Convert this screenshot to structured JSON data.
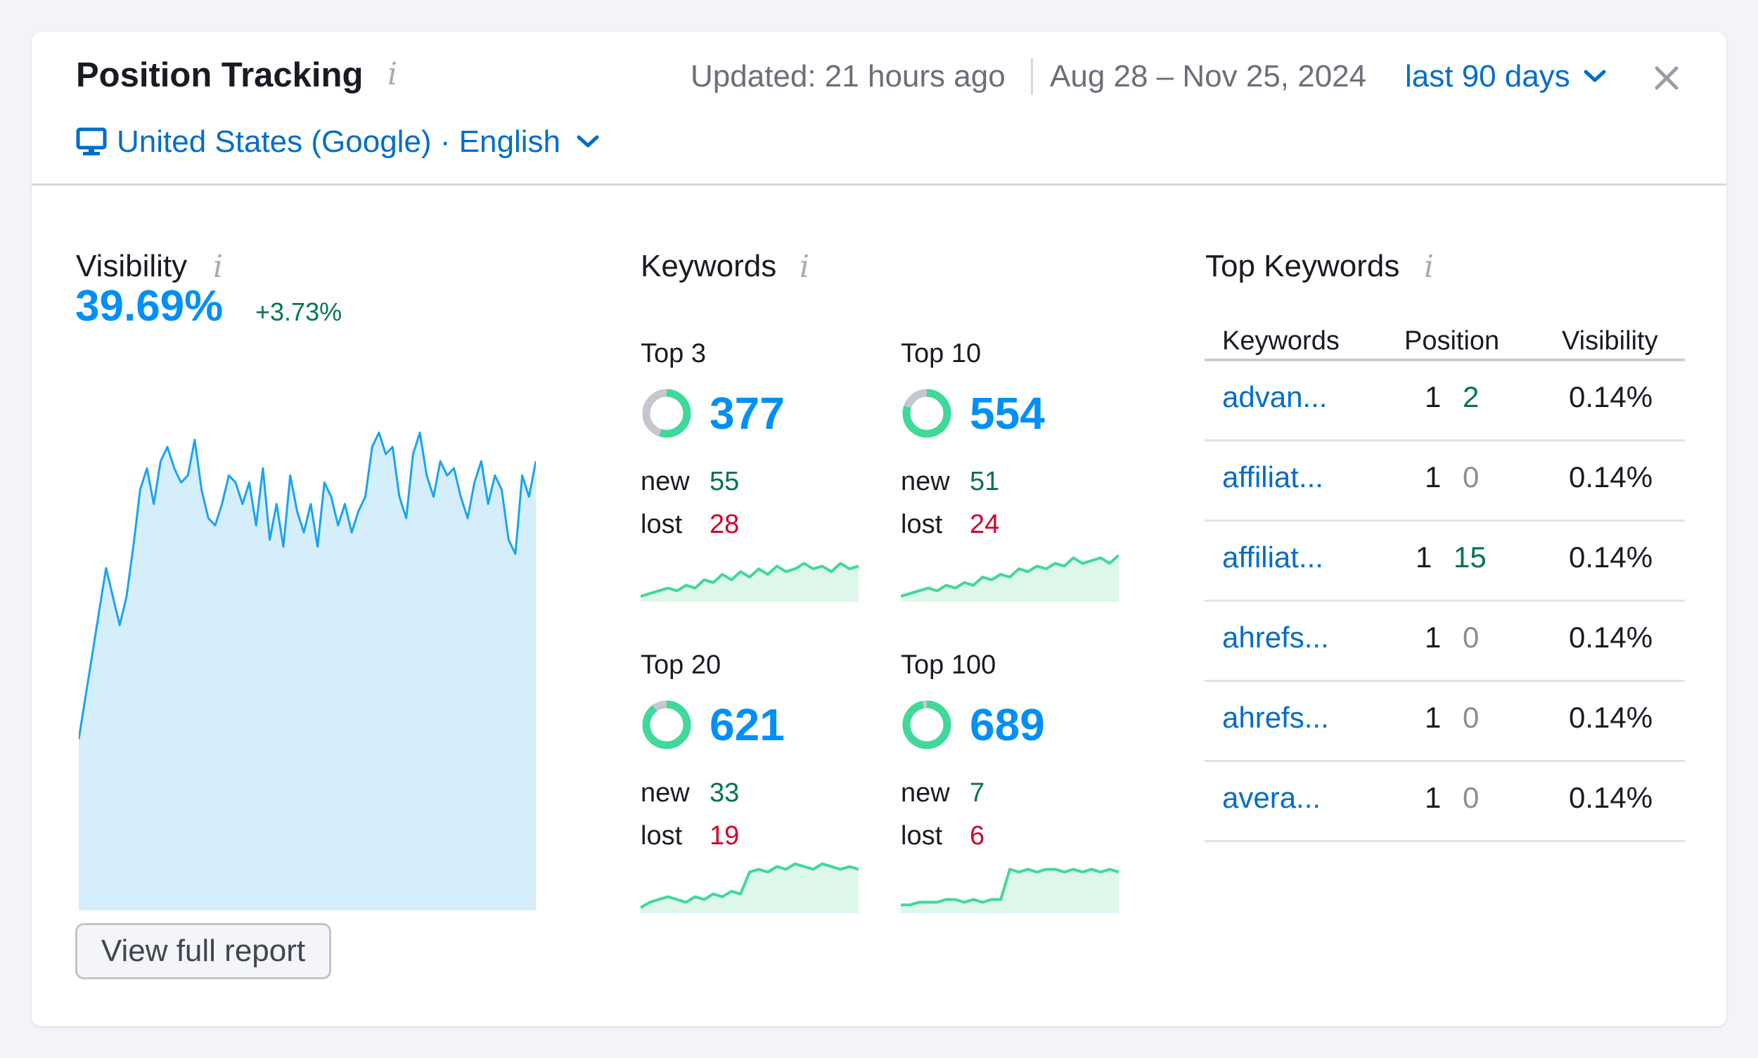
{
  "header": {
    "title": "Position Tracking",
    "info_glyph": "i",
    "updated": "Updated: 21 hours ago",
    "date_range": "Aug 28 – Nov 25, 2024",
    "period": "last 90 days",
    "close_icon": "close-icon",
    "location": "United States (Google) · English",
    "location_icon": "desktop-monitor-icon"
  },
  "visibility": {
    "title": "Visibility",
    "value": "39.69%",
    "delta": "+3.73%",
    "chart_data": {
      "type": "area",
      "values": [
        24,
        30,
        36,
        42,
        48,
        44,
        40,
        44,
        51,
        59,
        62,
        57,
        63,
        65,
        62,
        60,
        61,
        66,
        59,
        55,
        54,
        57,
        61,
        60,
        57,
        60,
        54,
        62,
        52,
        57,
        51,
        61,
        56,
        53,
        57,
        51,
        60,
        58,
        54,
        57,
        53,
        56,
        58,
        65,
        67,
        64,
        65,
        58,
        55,
        64,
        67,
        61,
        58,
        63,
        61,
        62,
        58,
        55,
        60,
        63,
        57,
        61,
        59,
        52,
        50,
        61,
        58,
        63
      ],
      "color": "#1aa3f0",
      "fill": "#d5eefc"
    }
  },
  "keywords": {
    "title": "Keywords",
    "new_label": "new",
    "lost_label": "lost",
    "groups": [
      {
        "label": "Top 3",
        "value": "377",
        "new": "55",
        "lost": "28",
        "donut_fraction": 0.55,
        "chart_data": {
          "type": "area",
          "values": [
            2,
            3,
            4,
            5,
            4,
            6,
            5,
            8,
            7,
            10,
            8,
            11,
            9,
            12,
            10,
            13,
            11,
            12,
            14,
            12,
            13,
            11,
            14,
            12,
            13
          ]
        }
      },
      {
        "label": "Top 10",
        "value": "554",
        "new": "51",
        "lost": "24",
        "donut_fraction": 0.8,
        "chart_data": {
          "type": "area",
          "values": [
            2,
            3,
            4,
            5,
            4,
            6,
            5,
            7,
            6,
            9,
            8,
            10,
            9,
            12,
            11,
            13,
            12,
            14,
            13,
            16,
            14,
            15,
            16,
            14,
            17
          ]
        }
      },
      {
        "label": "Top 20",
        "value": "621",
        "new": "33",
        "lost": "19",
        "donut_fraction": 0.9,
        "chart_data": {
          "type": "area",
          "values": [
            2,
            4,
            5,
            6,
            5,
            4,
            6,
            5,
            7,
            6,
            8,
            7,
            15,
            16,
            15,
            17,
            16,
            18,
            17,
            16,
            18,
            17,
            16,
            17,
            16
          ]
        }
      },
      {
        "label": "Top 100",
        "value": "689",
        "new": "7",
        "lost": "6",
        "donut_fraction": 0.97,
        "chart_data": {
          "type": "area",
          "values": [
            3,
            3,
            4,
            4,
            4,
            5,
            5,
            4,
            5,
            4,
            5,
            5,
            16,
            15,
            16,
            15,
            16,
            16,
            15,
            16,
            15,
            16,
            15,
            16,
            15
          ]
        }
      }
    ]
  },
  "top_keywords": {
    "title": "Top Keywords",
    "columns": [
      "Keywords",
      "Position",
      "Visibility"
    ],
    "rows": [
      {
        "keyword": "advan...",
        "position": "1",
        "change": "2",
        "change_color": "green",
        "visibility": "0.14%"
      },
      {
        "keyword": "affiliat...",
        "position": "1",
        "change": "0",
        "change_color": "gray",
        "visibility": "0.14%"
      },
      {
        "keyword": "affiliat...",
        "position": "1",
        "change": "15",
        "change_color": "green",
        "visibility": "0.14%"
      },
      {
        "keyword": "ahrefs...",
        "position": "1",
        "change": "0",
        "change_color": "gray",
        "visibility": "0.14%"
      },
      {
        "keyword": "ahrefs...",
        "position": "1",
        "change": "0",
        "change_color": "gray",
        "visibility": "0.14%"
      },
      {
        "keyword": "avera...",
        "position": "1",
        "change": "0",
        "change_color": "gray",
        "visibility": "0.14%"
      }
    ]
  },
  "footer": {
    "report_button": "View full report"
  },
  "colors": {
    "accent": "#008ff8",
    "link": "#006dca",
    "green": "#00754e",
    "red": "#d1002f",
    "spark": "#3fd99a",
    "spark_fill": "#ddf7ea",
    "donut_gray": "#c4c7cf"
  }
}
